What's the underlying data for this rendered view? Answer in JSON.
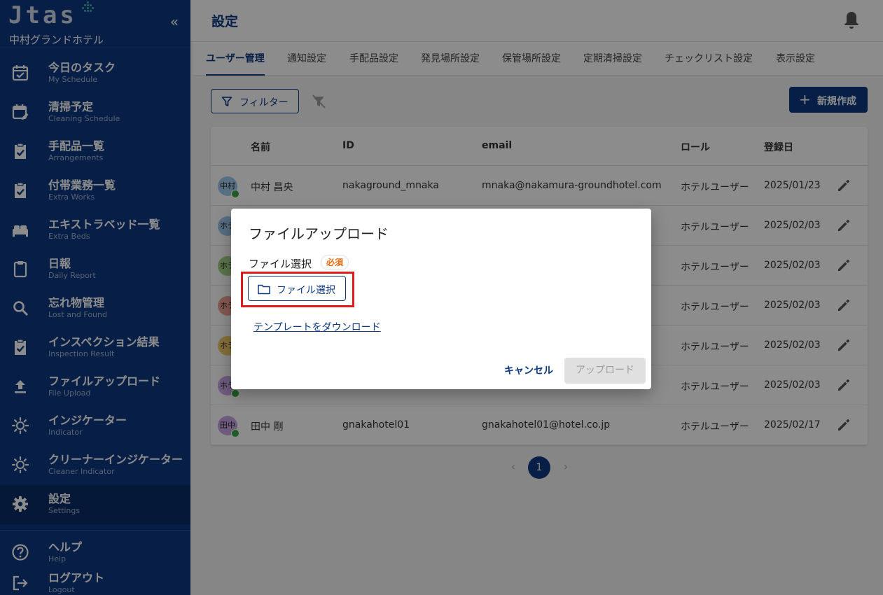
{
  "app": {
    "logo": "Jtas",
    "hotel_name": "中村グランドホテル",
    "collapse_glyph": "«"
  },
  "sidebar": {
    "items": [
      {
        "label": "今日のタスク",
        "sub": "My Schedule",
        "icon": "calendar-check-icon"
      },
      {
        "label": "清掃予定",
        "sub": "Cleaning Schedule",
        "icon": "calendar-edit-icon"
      },
      {
        "label": "手配品一覧",
        "sub": "Arrangements",
        "icon": "clipboard-check-icon"
      },
      {
        "label": "付帯業務一覧",
        "sub": "Extra Works",
        "icon": "clipboard-check-icon"
      },
      {
        "label": "エキストラベッド一覧",
        "sub": "Extra Beds",
        "icon": "bed-icon"
      },
      {
        "label": "日報",
        "sub": "Daily Report",
        "icon": "clipboard-icon"
      },
      {
        "label": "忘れ物管理",
        "sub": "Lost and Found",
        "icon": "search-icon"
      },
      {
        "label": "インスペクション結果",
        "sub": "Inspection Result",
        "icon": "clipboard-check-icon"
      },
      {
        "label": "ファイルアップロード",
        "sub": "File Upload",
        "icon": "upload-icon"
      },
      {
        "label": "インジケーター",
        "sub": "Indicator",
        "icon": "sun-icon"
      },
      {
        "label": "クリーナーインジケーター",
        "sub": "Cleaner Indicator",
        "icon": "sun-icon"
      },
      {
        "label": "設定",
        "sub": "Settings",
        "icon": "gear-icon",
        "active": true
      }
    ],
    "footer": [
      {
        "label": "ヘルプ",
        "sub": "Help",
        "icon": "help-icon"
      },
      {
        "label": "ログアウト",
        "sub": "Logout",
        "icon": "logout-icon"
      }
    ]
  },
  "header": {
    "title": "設定"
  },
  "tabs": [
    "ユーザー管理",
    "通知設定",
    "手配品設定",
    "発見場所設定",
    "保管場所設定",
    "定期清掃設定",
    "チェックリスト設定",
    "表示設定"
  ],
  "toolbar": {
    "filter_label": "フィルター",
    "new_label": "新規作成",
    "new_glyph": "+"
  },
  "table": {
    "headers": {
      "name": "名前",
      "id": "ID",
      "email": "email",
      "role": "ロール",
      "date": "登録日"
    },
    "rows": [
      {
        "avatar": "中村",
        "avatar_color": "#9ec9ee",
        "name": "中村 昌央",
        "id": "nakaground_mnaka",
        "email": "mnaka@nakamura-groundhotel.com",
        "role": "ホテルユーザー",
        "date": "2025/01/23"
      },
      {
        "avatar": "ホテ",
        "avatar_color": "#9ec9ee",
        "name": "",
        "id": "",
        "email": "",
        "role": "ホテルユーザー",
        "date": "2025/02/03"
      },
      {
        "avatar": "ホテ",
        "avatar_color": "#a6d38a",
        "name": "",
        "id": "",
        "email": "",
        "role": "ホテルユーザー",
        "date": "2025/02/03"
      },
      {
        "avatar": "ホテ",
        "avatar_color": "#f0a596",
        "name": "",
        "id": "",
        "email": "",
        "role": "ホテルユーザー",
        "date": "2025/02/03"
      },
      {
        "avatar": "ホテ",
        "avatar_color": "#f3cc6a",
        "name": "",
        "id": "",
        "email": "",
        "role": "ホテルユーザー",
        "date": "2025/02/03"
      },
      {
        "avatar": "ホテ",
        "avatar_color": "#cba6e6",
        "name": "",
        "id": "",
        "email": "",
        "role": "ホテルユーザー",
        "date": "2025/02/03"
      },
      {
        "avatar": "田中",
        "avatar_color": "#cba6e6",
        "name": "田中 剛",
        "id": "gnakahotel01",
        "email": "gnakahotel01@hotel.co.jp",
        "role": "ホテルユーザー",
        "date": "2025/02/17"
      }
    ]
  },
  "pagination": {
    "prev": "‹",
    "page": "1",
    "next": "›"
  },
  "modal": {
    "title": "ファイルアップロード",
    "field_label": "ファイル選択",
    "required_badge": "必須",
    "file_button": "ファイル選択",
    "template_link": "テンプレートをダウンロード",
    "cancel": "キャンセル",
    "upload": "アップロード"
  },
  "colors": {
    "primary": "#0d3a80",
    "highlight": "#e01b1b",
    "required": "#e46a12"
  }
}
